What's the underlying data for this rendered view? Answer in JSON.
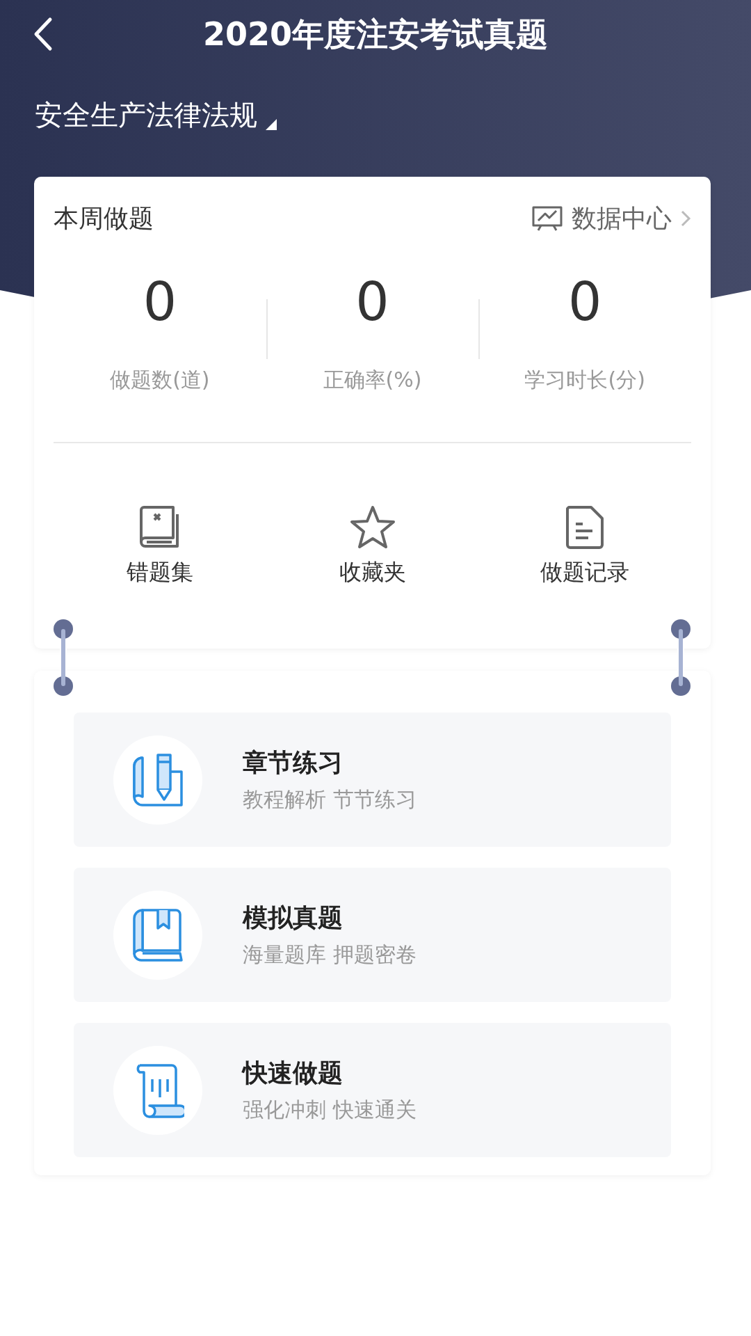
{
  "header": {
    "title": "2020年度注安考试真题",
    "subject": "安全生产法律法规"
  },
  "weekly": {
    "title": "本周做题",
    "link": "数据中心",
    "stats": [
      {
        "value": "0",
        "label": "做题数(道)"
      },
      {
        "value": "0",
        "label": "正确率(%)"
      },
      {
        "value": "0",
        "label": "学习时长(分)"
      }
    ],
    "actions": [
      {
        "kind": "wrong",
        "label": "错题集"
      },
      {
        "kind": "star",
        "label": "收藏夹"
      },
      {
        "kind": "record",
        "label": "做题记录"
      }
    ]
  },
  "practice": [
    {
      "kind": "chapter",
      "title": "章节练习",
      "subtitle": "教程解析 节节练习"
    },
    {
      "kind": "mock",
      "title": "模拟真题",
      "subtitle": "海量题库 押题密卷"
    },
    {
      "kind": "quick",
      "title": "快速做题",
      "subtitle": "强化冲刺 快速通关"
    }
  ]
}
